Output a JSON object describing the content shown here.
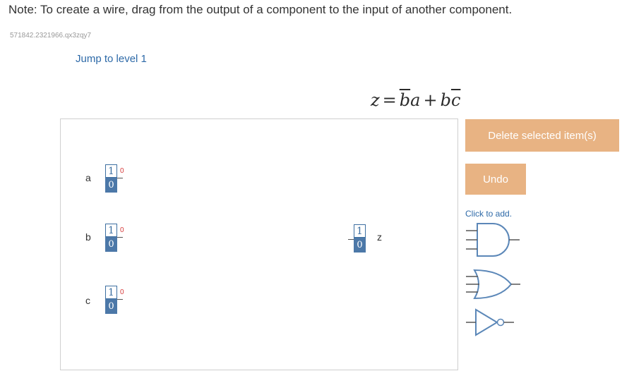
{
  "note": "Note: To create a wire, drag from the output of a component to the input of another component.",
  "code_id": "571842.2321966.qx3zqy7",
  "jump_link": "Jump to level 1",
  "equation": {
    "lhs": "z",
    "eq": "=",
    "t1": "b",
    "t2": "a",
    "plus": "+",
    "t3": "b",
    "t4": "c"
  },
  "inputs": [
    {
      "name": "a",
      "top_value": "1",
      "bottom_value": "0",
      "output": "0"
    },
    {
      "name": "b",
      "top_value": "1",
      "bottom_value": "0",
      "output": "0"
    },
    {
      "name": "c",
      "top_value": "1",
      "bottom_value": "0",
      "output": "0"
    }
  ],
  "output": {
    "name": "z",
    "top_value": "1",
    "bottom_value": "0"
  },
  "buttons": {
    "delete": "Delete selected item(s)",
    "undo": "Undo"
  },
  "palette": {
    "hint": "Click to add.",
    "gates": [
      "and-gate-icon",
      "or-gate-icon",
      "not-gate-icon"
    ]
  },
  "colors": {
    "button": "#e8b383",
    "toggle_blue": "#4c78a8",
    "link": "#2e6aa8",
    "output_red": "#d63a3a"
  }
}
